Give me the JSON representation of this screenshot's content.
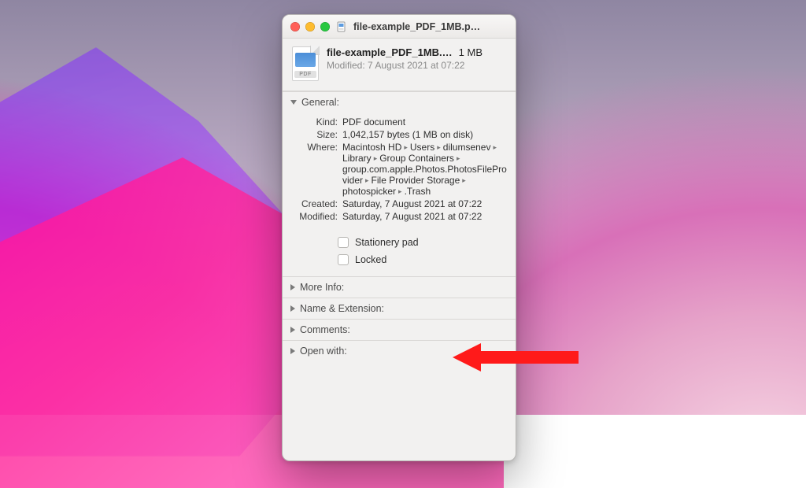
{
  "titlebar": {
    "title": "file-example_PDF_1MB.p…"
  },
  "header": {
    "filename": "file-example_PDF_1MB.…",
    "filesize": "1 MB",
    "modified_line": "Modified: 7 August 2021 at 07:22",
    "icon_badge": "PDF"
  },
  "general": {
    "heading": "General:",
    "kind_label": "Kind:",
    "kind_value": "PDF document",
    "size_label": "Size:",
    "size_value": "1,042,157 bytes (1 MB on disk)",
    "where_label": "Where:",
    "where_segments": [
      "Macintosh HD",
      "Users",
      "dilumsenev",
      "Library",
      "Group Containers",
      "group.com.apple.Photos.PhotosFileProvider",
      "File Provider Storage",
      "photospicker",
      ".Trash"
    ],
    "created_label": "Created:",
    "created_value": "Saturday, 7 August 2021 at 07:22",
    "modified_label": "Modified:",
    "modified_value": "Saturday, 7 August 2021 at 07:22",
    "stationery_label": "Stationery pad",
    "locked_label": "Locked"
  },
  "sections": {
    "more_info": "More Info:",
    "name_ext": "Name & Extension:",
    "comments": "Comments:",
    "open_with": "Open with:"
  },
  "annotation": {
    "arrow_color": "#ff1a1a"
  }
}
